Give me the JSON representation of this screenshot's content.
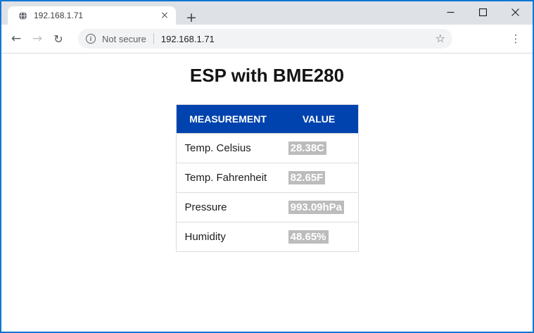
{
  "chrome": {
    "tab": {
      "title": "192.168.1.71"
    },
    "address_bar": {
      "security_label": "Not secure",
      "url": "192.168.1.71"
    }
  },
  "icons": {
    "tab_close": "×",
    "new_tab": "+",
    "back": "←",
    "forward": "→",
    "reload": "↻",
    "info": "i",
    "star": "☆",
    "menu": "⋮"
  },
  "page": {
    "heading": "ESP with BME280",
    "table": {
      "headers": [
        "MEASUREMENT",
        "VALUE"
      ],
      "rows": [
        {
          "measurement": "Temp. Celsius",
          "value": "28.38C"
        },
        {
          "measurement": "Temp. Fahrenheit",
          "value": "82.65F"
        },
        {
          "measurement": "Pressure",
          "value": "993.09hPa"
        },
        {
          "measurement": "Humidity",
          "value": "48.65%"
        }
      ]
    }
  },
  "colors": {
    "window_border": "#0f76d3",
    "tab_strip_bg": "#dee1e6",
    "omnibox_bg": "#f1f3f4",
    "table_header_bg": "#0043af",
    "value_badge_bg": "#bcbcbc",
    "row_border": "#dddddd"
  }
}
